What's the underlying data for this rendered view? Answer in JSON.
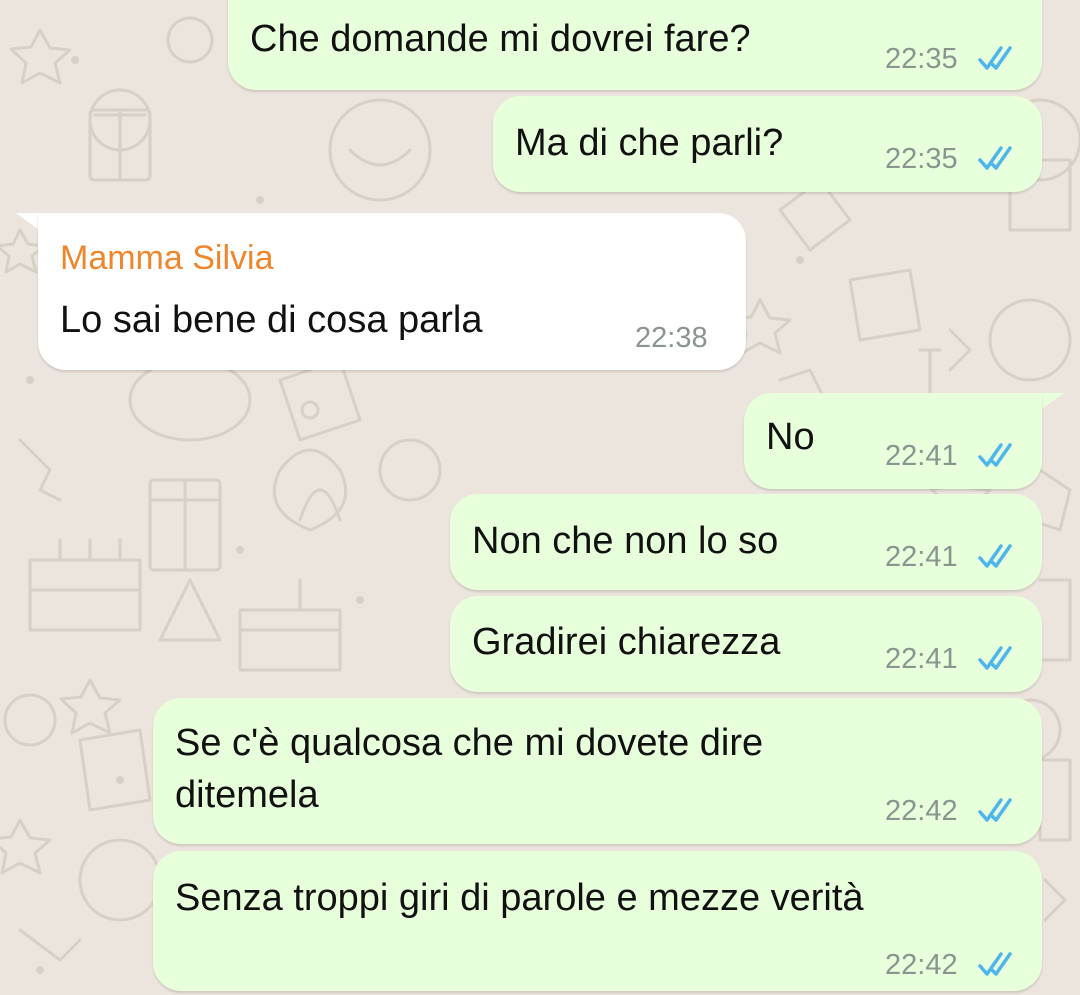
{
  "colors": {
    "outgoing_bubble": "#e7ffdb",
    "incoming_bubble": "#ffffff",
    "background": "#ece5dd",
    "read_ticks": "#4fb6ec",
    "sender_name": "#f0862c",
    "timestamp": "#8b9590"
  },
  "messages": [
    {
      "direction": "outgoing",
      "text": "Che domande mi dovrei fare?",
      "time": "22:35",
      "status": "read-double-check-icon"
    },
    {
      "direction": "outgoing",
      "text": "Ma di che parli?",
      "time": "22:35",
      "status": "read-double-check-icon"
    },
    {
      "direction": "incoming",
      "sender": "Mamma Silvia",
      "text": "Lo sai bene di cosa parla",
      "time": "22:38"
    },
    {
      "direction": "outgoing",
      "text": "No",
      "time": "22:41",
      "status": "read-double-check-icon"
    },
    {
      "direction": "outgoing",
      "text": "Non che non lo so",
      "time": "22:41",
      "status": "read-double-check-icon"
    },
    {
      "direction": "outgoing",
      "text": "Gradirei chiarezza",
      "time": "22:41",
      "status": "read-double-check-icon"
    },
    {
      "direction": "outgoing",
      "text_line1": "Se c'è qualcosa che mi dovete dire",
      "text_line2": "ditemela",
      "time": "22:42",
      "status": "read-double-check-icon"
    },
    {
      "direction": "outgoing",
      "text": "Senza troppi giri di parole e mezze verità",
      "time": "22:42",
      "status": "read-double-check-icon"
    }
  ]
}
